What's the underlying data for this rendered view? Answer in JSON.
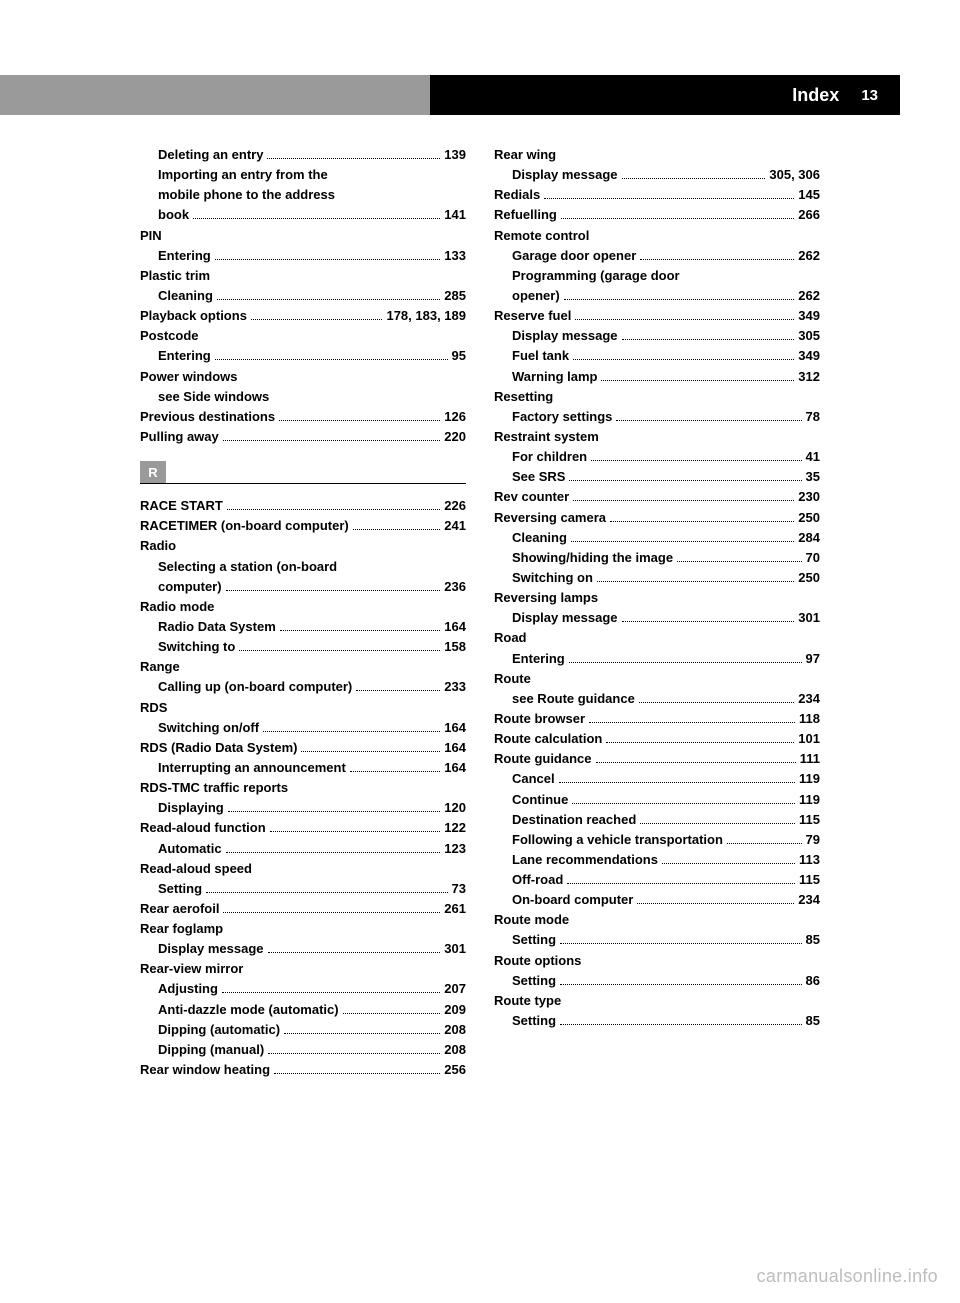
{
  "header": {
    "title": "Index",
    "page": "13"
  },
  "section_marker": "R",
  "watermark": "carmanualsonline.info",
  "left": [
    {
      "t": "sub",
      "label": "Deleting an entry",
      "page": "139"
    },
    {
      "t": "sub",
      "label": "Importing an entry from the",
      "page": "",
      "nopage": true
    },
    {
      "t": "sub",
      "label": "mobile phone to the address",
      "page": "",
      "nopage": true
    },
    {
      "t": "sub",
      "label": "book",
      "page": "141"
    },
    {
      "t": "main",
      "label": "PIN",
      "page": "",
      "nopage": true
    },
    {
      "t": "sub",
      "label": "Entering",
      "page": "133"
    },
    {
      "t": "main",
      "label": "Plastic trim",
      "page": "",
      "nopage": true
    },
    {
      "t": "sub",
      "label": "Cleaning",
      "page": "285"
    },
    {
      "t": "main",
      "label": "Playback options",
      "page": "178, 183, 189"
    },
    {
      "t": "main",
      "label": "Postcode",
      "page": "",
      "nopage": true
    },
    {
      "t": "sub",
      "label": "Entering",
      "page": "95"
    },
    {
      "t": "main",
      "label": "Power windows",
      "page": "",
      "nopage": true
    },
    {
      "t": "sub",
      "label": "see Side windows",
      "page": "",
      "nopage": true
    },
    {
      "t": "main",
      "label": "Previous destinations",
      "page": "126"
    },
    {
      "t": "main",
      "label": "Pulling away",
      "page": "220"
    }
  ],
  "left_r": [
    {
      "t": "main",
      "label": "RACE START",
      "page": "226"
    },
    {
      "t": "main",
      "label": "RACETIMER (on-board computer)",
      "page": "241"
    },
    {
      "t": "main",
      "label": "Radio",
      "page": "",
      "nopage": true
    },
    {
      "t": "sub",
      "label": "Selecting a station (on-board",
      "page": "",
      "nopage": true
    },
    {
      "t": "sub",
      "label": "computer)",
      "page": "236"
    },
    {
      "t": "main",
      "label": "Radio mode",
      "page": "",
      "nopage": true
    },
    {
      "t": "sub",
      "label": "Radio Data System",
      "page": "164"
    },
    {
      "t": "sub",
      "label": "Switching to",
      "page": "158"
    },
    {
      "t": "main",
      "label": "Range",
      "page": "",
      "nopage": true
    },
    {
      "t": "sub",
      "label": "Calling up (on-board computer)",
      "page": "233"
    },
    {
      "t": "main",
      "label": "RDS",
      "page": "",
      "nopage": true
    },
    {
      "t": "sub",
      "label": "Switching on/off",
      "page": "164"
    },
    {
      "t": "main",
      "label": "RDS (Radio Data System)",
      "page": "164"
    },
    {
      "t": "sub",
      "label": "Interrupting an announcement",
      "page": "164"
    },
    {
      "t": "main",
      "label": "RDS-TMC traffic reports",
      "page": "",
      "nopage": true
    },
    {
      "t": "sub",
      "label": "Displaying",
      "page": "120"
    },
    {
      "t": "main",
      "label": "Read-aloud function",
      "page": "122"
    },
    {
      "t": "sub",
      "label": "Automatic",
      "page": "123"
    },
    {
      "t": "main",
      "label": "Read-aloud speed",
      "page": "",
      "nopage": true
    },
    {
      "t": "sub",
      "label": "Setting",
      "page": "73"
    },
    {
      "t": "main",
      "label": "Rear aerofoil",
      "page": "261"
    },
    {
      "t": "main",
      "label": "Rear foglamp",
      "page": "",
      "nopage": true
    },
    {
      "t": "sub",
      "label": "Display message",
      "page": "301"
    },
    {
      "t": "main",
      "label": "Rear-view mirror",
      "page": "",
      "nopage": true
    },
    {
      "t": "sub",
      "label": "Adjusting",
      "page": "207"
    },
    {
      "t": "sub",
      "label": "Anti-dazzle mode (automatic)",
      "page": "209"
    },
    {
      "t": "sub",
      "label": "Dipping (automatic)",
      "page": "208"
    },
    {
      "t": "sub",
      "label": "Dipping (manual)",
      "page": "208"
    },
    {
      "t": "main",
      "label": "Rear window heating",
      "page": "256"
    }
  ],
  "right": [
    {
      "t": "main",
      "label": "Rear wing",
      "page": "",
      "nopage": true
    },
    {
      "t": "sub",
      "label": "Display message",
      "page": "305, 306"
    },
    {
      "t": "main",
      "label": "Redials",
      "page": "145"
    },
    {
      "t": "main",
      "label": "Refuelling",
      "page": "266"
    },
    {
      "t": "main",
      "label": "Remote control",
      "page": "",
      "nopage": true
    },
    {
      "t": "sub",
      "label": "Garage door opener",
      "page": "262"
    },
    {
      "t": "sub",
      "label": "Programming (garage door",
      "page": "",
      "nopage": true
    },
    {
      "t": "sub",
      "label": "opener)",
      "page": "262"
    },
    {
      "t": "main",
      "label": "Reserve fuel",
      "page": "349"
    },
    {
      "t": "sub",
      "label": "Display message",
      "page": "305"
    },
    {
      "t": "sub",
      "label": "Fuel tank",
      "page": "349"
    },
    {
      "t": "sub",
      "label": "Warning lamp",
      "page": "312"
    },
    {
      "t": "main",
      "label": "Resetting",
      "page": "",
      "nopage": true
    },
    {
      "t": "sub",
      "label": "Factory settings",
      "page": "78"
    },
    {
      "t": "main",
      "label": "Restraint system",
      "page": "",
      "nopage": true
    },
    {
      "t": "sub",
      "label": "For children",
      "page": "41"
    },
    {
      "t": "sub",
      "label": "See SRS",
      "page": "35"
    },
    {
      "t": "main",
      "label": "Rev counter",
      "page": "230"
    },
    {
      "t": "main",
      "label": "Reversing camera",
      "page": "250"
    },
    {
      "t": "sub",
      "label": "Cleaning",
      "page": "284"
    },
    {
      "t": "sub",
      "label": "Showing/hiding the image",
      "page": "70"
    },
    {
      "t": "sub",
      "label": "Switching on",
      "page": "250"
    },
    {
      "t": "main",
      "label": "Reversing lamps",
      "page": "",
      "nopage": true
    },
    {
      "t": "sub",
      "label": "Display message",
      "page": "301"
    },
    {
      "t": "main",
      "label": "Road",
      "page": "",
      "nopage": true
    },
    {
      "t": "sub",
      "label": "Entering",
      "page": "97"
    },
    {
      "t": "main",
      "label": "Route",
      "page": "",
      "nopage": true
    },
    {
      "t": "sub",
      "label": "see Route guidance",
      "page": "234"
    },
    {
      "t": "main",
      "label": "Route browser",
      "page": "118"
    },
    {
      "t": "main",
      "label": "Route calculation",
      "page": "101"
    },
    {
      "t": "main",
      "label": "Route guidance",
      "page": "111"
    },
    {
      "t": "sub",
      "label": "Cancel",
      "page": "119"
    },
    {
      "t": "sub",
      "label": "Continue",
      "page": "119"
    },
    {
      "t": "sub",
      "label": "Destination reached",
      "page": "115"
    },
    {
      "t": "sub",
      "label": "Following a vehicle transportation",
      "page": "79"
    },
    {
      "t": "sub",
      "label": "Lane recommendations",
      "page": "113"
    },
    {
      "t": "sub",
      "label": "Off-road",
      "page": "115"
    },
    {
      "t": "sub",
      "label": "On-board computer",
      "page": "234"
    },
    {
      "t": "main",
      "label": "Route mode",
      "page": "",
      "nopage": true
    },
    {
      "t": "sub",
      "label": "Setting",
      "page": "85"
    },
    {
      "t": "main",
      "label": "Route options",
      "page": "",
      "nopage": true
    },
    {
      "t": "sub",
      "label": "Setting",
      "page": "86"
    },
    {
      "t": "main",
      "label": "Route type",
      "page": "",
      "nopage": true
    },
    {
      "t": "sub",
      "label": "Setting",
      "page": "85"
    }
  ]
}
